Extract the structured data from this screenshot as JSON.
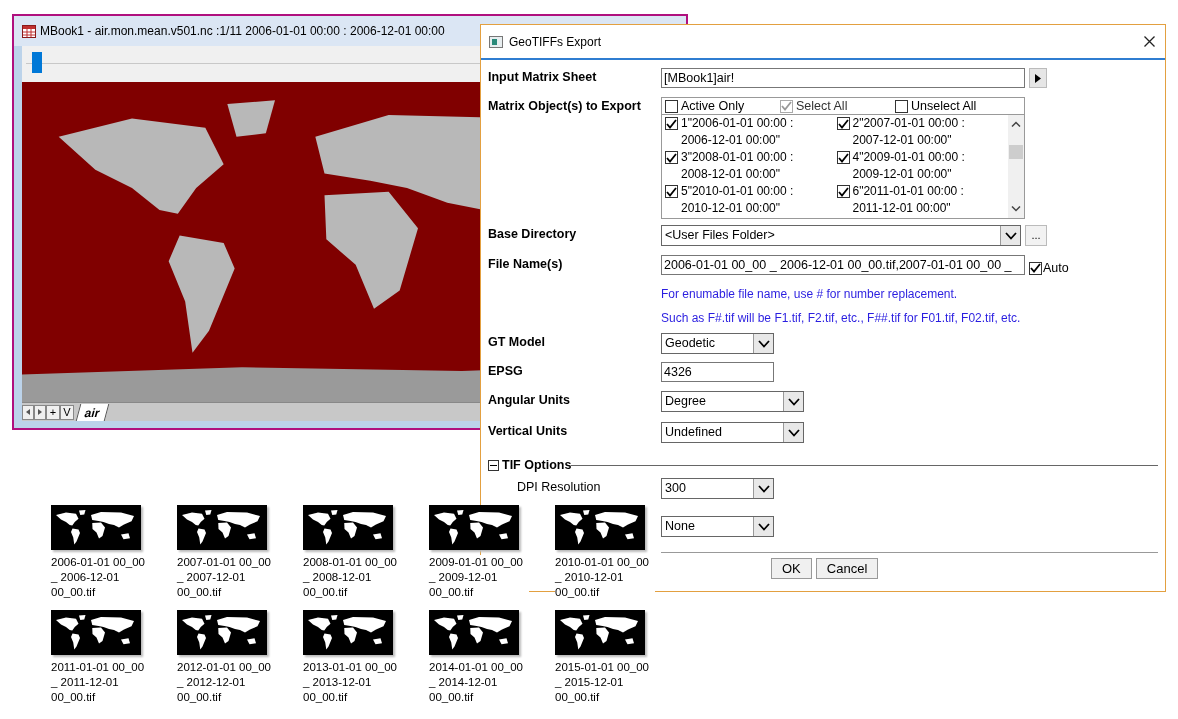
{
  "workbook_window": {
    "title": "MBook1 - air.mon.mean.v501.nc :1/11 2006-01-01 00:00 : 2006-12-01 00:00",
    "slider": {
      "level": 0.01
    },
    "sheet_nav": [
      "+",
      "V"
    ],
    "sheet_tabs": [
      {
        "label": "air",
        "selected": true
      }
    ]
  },
  "dialog": {
    "title": "GeoTIFFs Export",
    "input_matrix_sheet": {
      "label": "Input Matrix Sheet",
      "value": "[MBook1]air!"
    },
    "matrix_objects": {
      "label": "Matrix Object(s) to Export",
      "options": [
        {
          "label": "Active Only",
          "checked": false,
          "disabled": false
        },
        {
          "label": "Select All",
          "checked": true,
          "disabled": true
        },
        {
          "label": "Unselect All",
          "checked": false,
          "disabled": false
        }
      ],
      "items": [
        {
          "label": "1\"2006-01-01 00:00 : 2006-12-01 00:00\"",
          "checked": true
        },
        {
          "label": "2\"2007-01-01 00:00 : 2007-12-01 00:00\"",
          "checked": true
        },
        {
          "label": "3\"2008-01-01 00:00 : 2008-12-01 00:00\"",
          "checked": true
        },
        {
          "label": "4\"2009-01-01 00:00 : 2009-12-01 00:00\"",
          "checked": true
        },
        {
          "label": "5\"2010-01-01 00:00 : 2010-12-01 00:00\"",
          "checked": true
        },
        {
          "label": "6\"2011-01-01 00:00 : 2011-12-01 00:00\"",
          "checked": true
        }
      ]
    },
    "base_directory": {
      "label": "Base Directory",
      "value": "<User Files Folder>",
      "browse": "..."
    },
    "file_names": {
      "label": "File Name(s)",
      "value": "2006-01-01 00_00 _ 2006-12-01 00_00.tif,2007-01-01 00_00 _",
      "auto": {
        "label": "Auto",
        "checked": true
      }
    },
    "hints": [
      "For enumable file name, use # for number replacement.",
      "Such as F#.tif will be F1.tif, F2.tif, etc., F##.tif for F01.tif, F02.tif, etc."
    ],
    "gt_model": {
      "label": "GT Model",
      "value": "Geodetic"
    },
    "epsg": {
      "label": "EPSG",
      "value": "4326"
    },
    "angular_units": {
      "label": "Angular Units",
      "value": "Degree"
    },
    "vertical_units": {
      "label": "Vertical Units",
      "value": "Undefined"
    },
    "tif_options": {
      "label": "TIF Options",
      "expanded": true,
      "dpi": {
        "label": "DPI Resolution",
        "value": "300"
      },
      "option_2": {
        "value": "None"
      }
    },
    "buttons": [
      "OK",
      "Cancel"
    ]
  },
  "exported_files": [
    {
      "name": "2006-01-01 00_00 _ 2006-12-01 00_00.tif"
    },
    {
      "name": "2007-01-01 00_00 _ 2007-12-01 00_00.tif"
    },
    {
      "name": "2008-01-01 00_00 _ 2008-12-01 00_00.tif"
    },
    {
      "name": "2009-01-01 00_00 _ 2009-12-01 00_00.tif"
    },
    {
      "name": "2010-01-01 00_00 _ 2010-12-01 00_00.tif"
    },
    {
      "name": "2011-01-01 00_00 _ 2011-12-01 00_00.tif"
    },
    {
      "name": "2012-01-01 00_00 _ 2012-12-01 00_00.tif"
    },
    {
      "name": "2013-01-01 00_00 _ 2013-12-01 00_00.tif"
    },
    {
      "name": "2014-01-01 00_00 _ 2014-12-01 00_00.tif"
    },
    {
      "name": "2015-01-01 00_00 _ 2015-12-01 00_00.tif"
    }
  ]
}
